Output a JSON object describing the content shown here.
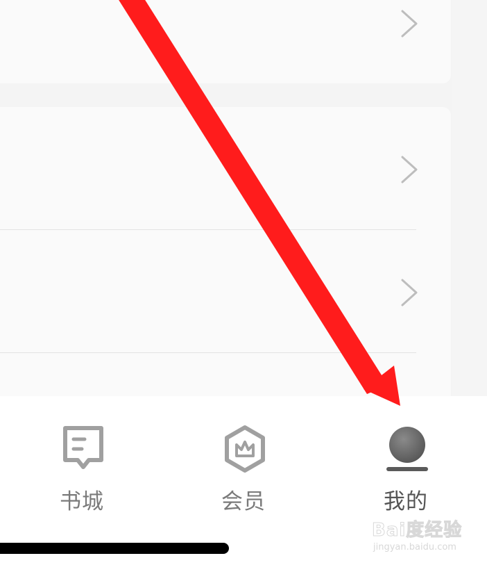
{
  "tabbar": {
    "tabs": [
      {
        "label": "书城",
        "icon": "bookstore-icon"
      },
      {
        "label": "会员",
        "icon": "vip-crown-icon"
      },
      {
        "label": "我的",
        "icon": "profile-avatar-icon"
      }
    ]
  },
  "watermark": {
    "main": "Bai度经验",
    "sub": "jingyan.baidu.com"
  },
  "colors": {
    "annotation_arrow": "#ff1c1c",
    "tab_label": "#7a7a7a",
    "avatar": "#6e6e6e"
  }
}
